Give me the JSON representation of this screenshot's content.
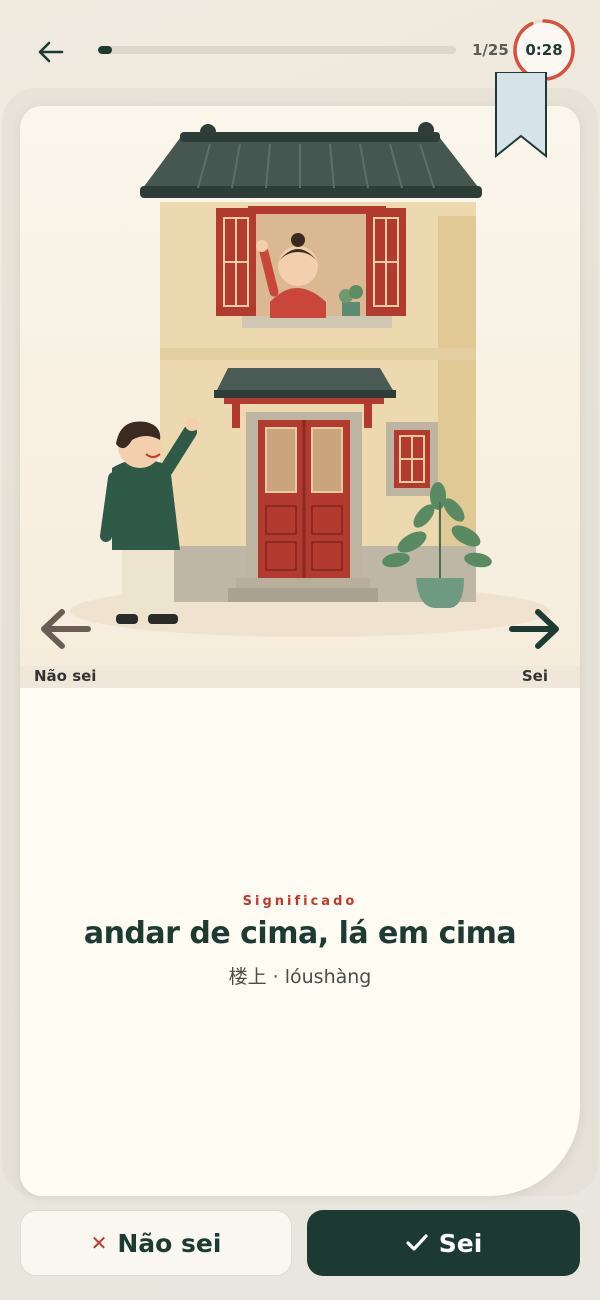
{
  "header": {
    "progress_text": "1/25",
    "progress_fraction": 0.04,
    "timer": "0:28",
    "timer_fraction": 0.93
  },
  "card": {
    "swipe_left_label": "Não sei",
    "swipe_right_label": "Sei",
    "meaning_label": "Significado",
    "meaning": "andar de cima, lá em cima",
    "reading": "楼上 · lóushàng"
  },
  "actions": {
    "dont_know_label": "Não sei",
    "know_label": "Sei"
  },
  "colors": {
    "primary": "#1c3a32",
    "accent_red": "#c0392b",
    "card_bg": "#fffcf4"
  },
  "icons": {
    "back": "arrow-left-icon",
    "dont_know": "x-icon",
    "know": "check-icon"
  }
}
